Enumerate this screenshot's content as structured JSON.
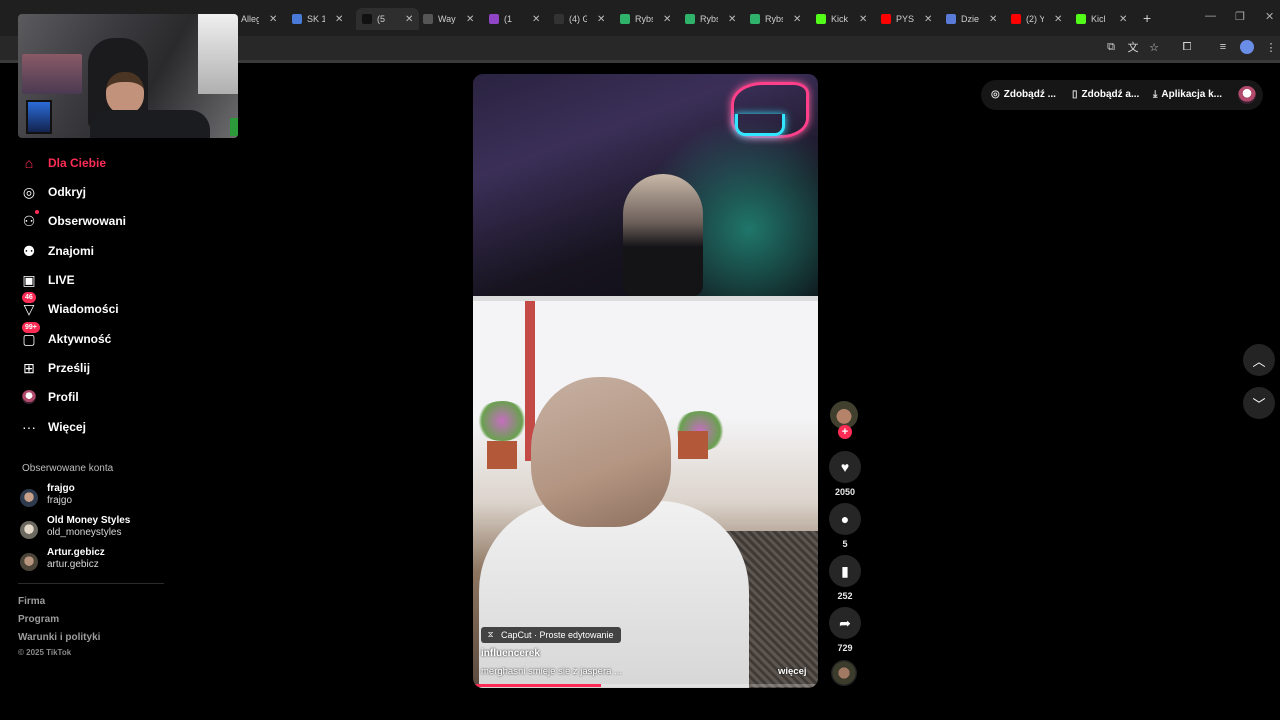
{
  "browser": {
    "tabs": [
      {
        "title": "Alleg",
        "color": "#ff6a00"
      },
      {
        "title": "SK 1(",
        "color": "#4a7ad8"
      },
      {
        "title": "(5",
        "color": "#111111",
        "active": true
      },
      {
        "title": "Wayb",
        "color": "#555555"
      },
      {
        "title": "(1",
        "color": "#8f45c6"
      },
      {
        "title": "(4) Gi",
        "color": "#333333"
      },
      {
        "title": "Rybs",
        "color": "#2fb36a"
      },
      {
        "title": "Rybs",
        "color": "#2fb36a"
      },
      {
        "title": "Rybs",
        "color": "#2fb36a"
      },
      {
        "title": "Kick",
        "color": "#53fc18"
      },
      {
        "title": "PYSZ",
        "color": "#ff0000"
      },
      {
        "title": "Dzie",
        "color": "#5a7ad8"
      },
      {
        "title": "(2) Y",
        "color": "#ff0000"
      },
      {
        "title": "Kicl",
        "color": "#53fc18"
      }
    ],
    "new_tab_icon": "plus-icon"
  },
  "sidebar": {
    "items": [
      {
        "label": "Dla Ciebie",
        "icon": "home-icon",
        "active": true
      },
      {
        "label": "Odkryj",
        "icon": "compass-icon"
      },
      {
        "label": "Obserwowani",
        "icon": "user-follow-icon"
      },
      {
        "label": "Znajomi",
        "icon": "friends-icon"
      },
      {
        "label": "LIVE",
        "icon": "live-icon"
      },
      {
        "label": "Wiadomości",
        "icon": "messages-icon",
        "badge": "46"
      },
      {
        "label": "Aktywność",
        "icon": "activity-icon",
        "badge": "99+"
      },
      {
        "label": "Prześlij",
        "icon": "upload-icon"
      },
      {
        "label": "Profil",
        "icon": "profile-avatar"
      },
      {
        "label": "Więcej",
        "icon": "more-icon"
      }
    ],
    "followed_title": "Obserwowane konta",
    "followed": [
      {
        "name": "frajgo",
        "handle": "frajgo"
      },
      {
        "name": "Old Money Styles",
        "handle": "old_moneystyles"
      },
      {
        "name": "Artur.gebicz",
        "handle": "artur.gebicz"
      }
    ],
    "footer": {
      "links": [
        "Firma",
        "Program",
        "Warunki i polityki"
      ],
      "copyright": "© 2025 TikTok"
    }
  },
  "top_actions": {
    "coins_label": "Zdobądź ...",
    "app_label": "Zdobądź a...",
    "desktop_label": "Aplikacja k..."
  },
  "video": {
    "capcut_label": "CapCut · Proste edytowanie",
    "author": "influencerek",
    "description": "merghasni smieje sie z jaspera ...",
    "more_label": "więcej",
    "progress": 0.37
  },
  "actions": {
    "likes": "2050",
    "comments": "5",
    "saves": "252",
    "shares": "729"
  },
  "colors": {
    "accent": "#fe2c55",
    "background": "#000000"
  }
}
